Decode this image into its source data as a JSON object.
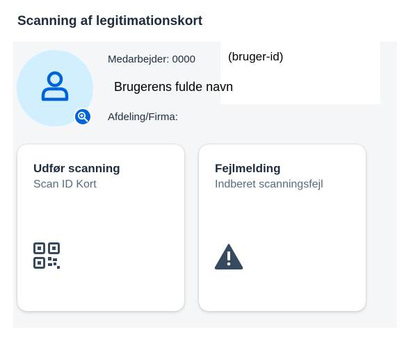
{
  "page": {
    "title": "Scanning af legitimationskort"
  },
  "employee": {
    "label": "Medarbejder: 0000",
    "id_hint": "(bruger-id)",
    "full_name": "Brugerens fulde navn",
    "department_label": "Afdeling/Firma:"
  },
  "tiles": [
    {
      "title": "Udfør scanning",
      "subtitle": "Scan ID Kort",
      "icon": "qr-code-icon"
    },
    {
      "title": "Fejlmelding",
      "subtitle": "Indberet scanningsfejl",
      "icon": "warning-icon"
    }
  ],
  "colors": {
    "accent": "#0064d9",
    "avatar_bg": "#d1efff",
    "icon_dark": "#354a5f",
    "title_text": "#1d2d3e",
    "sub_text": "#556b82"
  }
}
